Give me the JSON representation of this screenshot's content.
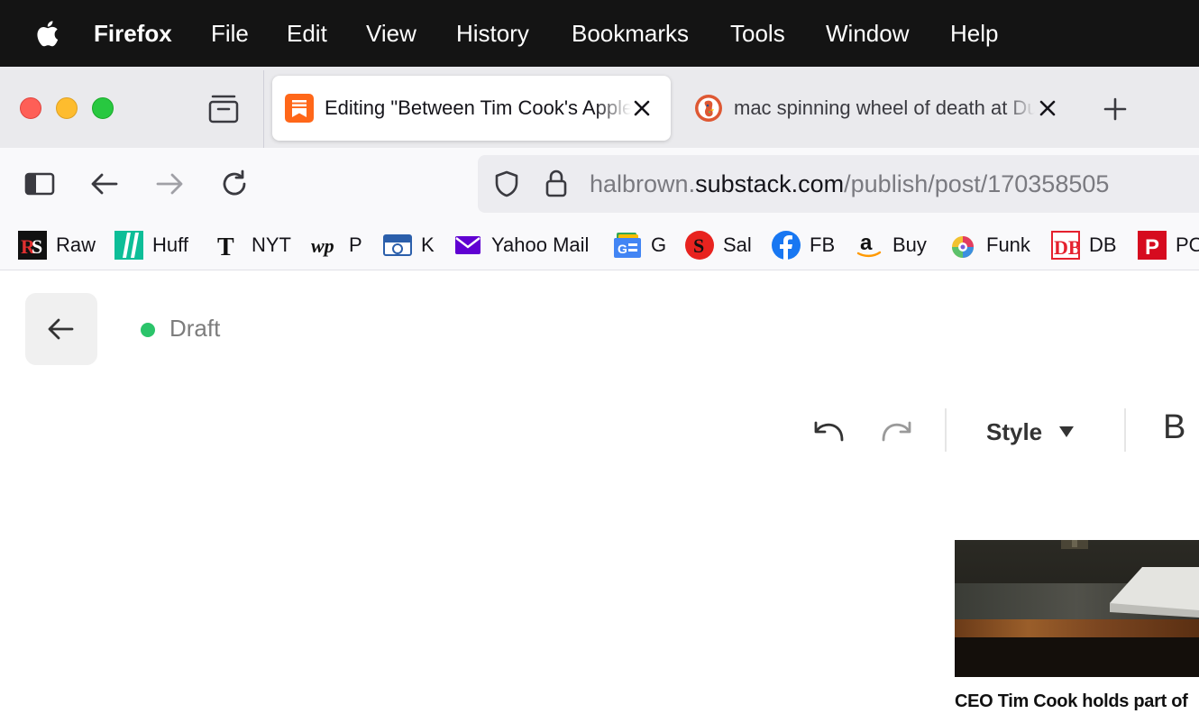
{
  "menubar": {
    "app_name": "Firefox",
    "items": [
      "File",
      "Edit",
      "View",
      "History",
      "Bookmarks",
      "Tools",
      "Window",
      "Help"
    ]
  },
  "tabs": [
    {
      "title": "Editing \"Between Tim Cook's Apple",
      "favicon": "substack-icon",
      "active": true
    },
    {
      "title": "mac spinning wheel of death at DuckDuckGo",
      "favicon": "duckduckgo-icon",
      "active": false
    }
  ],
  "url": {
    "prefix": "halbrown.",
    "domain": "substack.com",
    "path": "/publish/post/170358505"
  },
  "bookmarks": [
    {
      "label": "Raw",
      "icon": "raw-story-icon"
    },
    {
      "label": "Huff",
      "icon": "huffpost-icon"
    },
    {
      "label": "NYT",
      "icon": "nyt-icon"
    },
    {
      "label": "P",
      "icon": "washington-post-icon"
    },
    {
      "label": "K",
      "icon": "koin-icon"
    },
    {
      "label": "Yahoo Mail",
      "icon": "yahoo-mail-icon"
    },
    {
      "label": "G",
      "icon": "google-news-icon"
    },
    {
      "label": "Sal",
      "icon": "salon-icon"
    },
    {
      "label": "FB",
      "icon": "facebook-icon"
    },
    {
      "label": "Buy",
      "icon": "amazon-icon"
    },
    {
      "label": "Funk",
      "icon": "funk-icon"
    },
    {
      "label": "DB",
      "icon": "daily-beast-icon"
    },
    {
      "label": "PO",
      "icon": "politico-icon"
    }
  ],
  "editor": {
    "status": "Draft",
    "style_label": "Style",
    "bold_label": "B",
    "caption": "CEO Tim Cook holds part of"
  },
  "colors": {
    "menubar_bg": "#141414",
    "tabstrip_bg": "#eaeaed",
    "draft_dot": "#2bc46a",
    "substack_orange": "#ff6719"
  }
}
